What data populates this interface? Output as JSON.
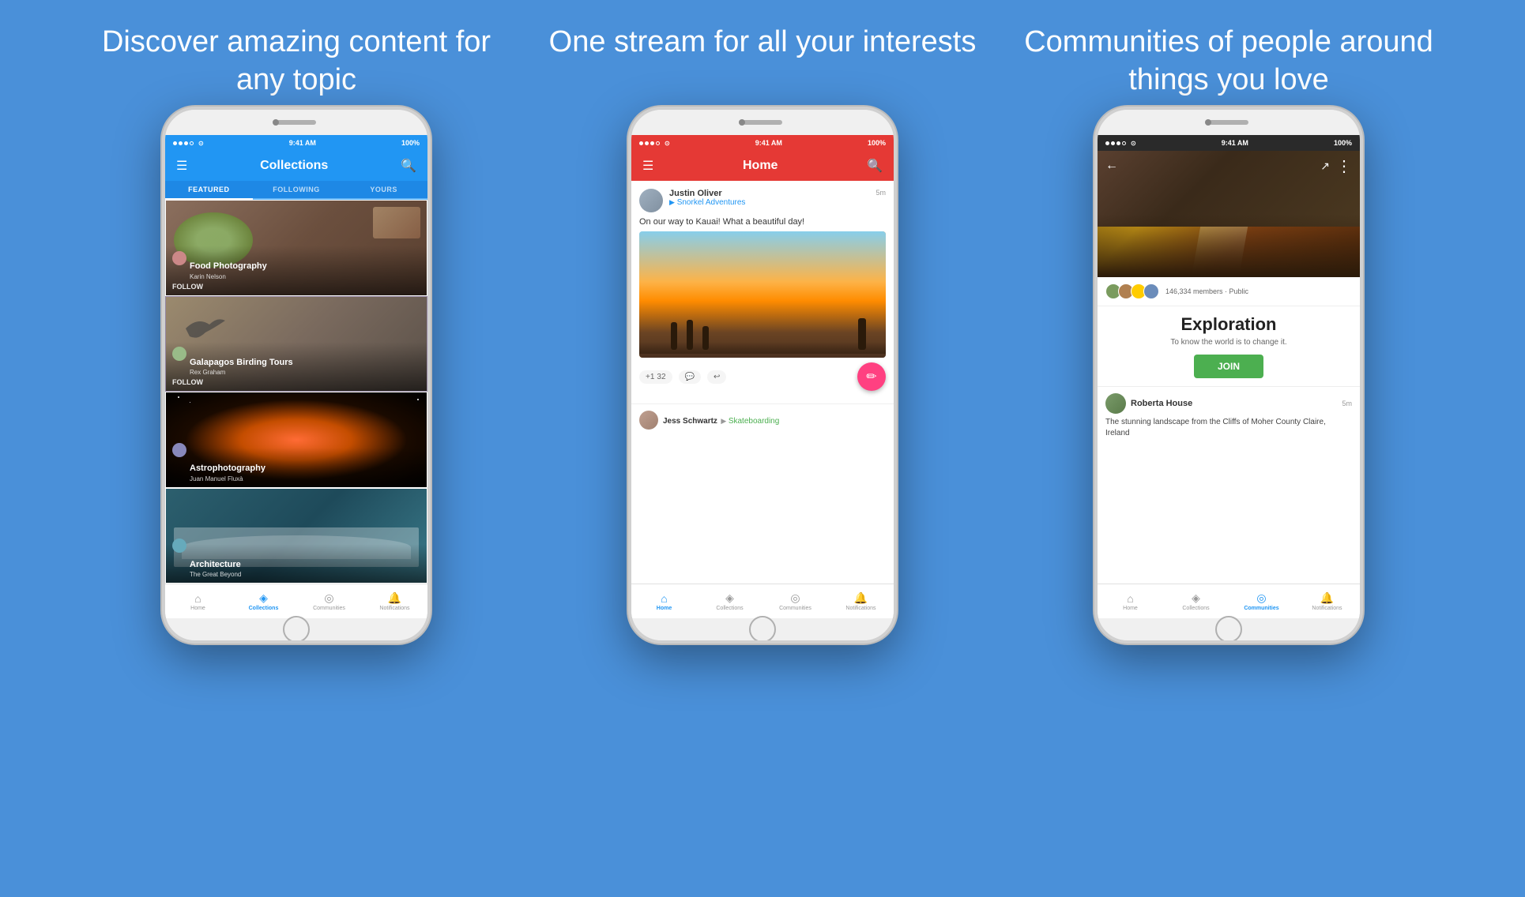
{
  "headlines": {
    "left": "Discover amazing content for any topic",
    "center": "One stream for all your interests",
    "right": "Communities of people around things you love"
  },
  "phone1": {
    "status_time": "9:41 AM",
    "status_battery": "100%",
    "app_bar_title": "Collections",
    "tabs": [
      "FEATURED",
      "FOLLOWING",
      "YOURS"
    ],
    "active_tab": "FEATURED",
    "collections": [
      {
        "title": "Food Photography",
        "author": "Karin Nelson",
        "action": "FOLLOW",
        "color": "#8B6F5E"
      },
      {
        "title": "Galapagos Birding Tours",
        "author": "Rex Graham",
        "action": "FOLLOW",
        "color": "#7B6A8D"
      },
      {
        "title": "Astrophotography",
        "author": "Juan Manuel Fluxà",
        "action": "",
        "color": "#1a1a2e"
      },
      {
        "title": "Architecture",
        "author": "The Great Beyond",
        "action": "",
        "color": "#2c5f6e"
      }
    ],
    "nav_items": [
      {
        "label": "Home",
        "active": false
      },
      {
        "label": "Collections",
        "active": true
      },
      {
        "label": "Communities",
        "active": false
      },
      {
        "label": "Notifications",
        "active": false
      }
    ]
  },
  "phone2": {
    "status_time": "9:41 AM",
    "status_battery": "100%",
    "app_bar_title": "Home",
    "post1": {
      "username": "Justin Oliver",
      "community": "Snorkel Adventures",
      "time": "5m",
      "text": "On our way to Kauai! What a beautiful day!",
      "plus_count": "+1",
      "comment_count": "32"
    },
    "post2": {
      "username": "Jess Schwartz",
      "community": "Skateboarding"
    },
    "nav_items": [
      {
        "label": "Home",
        "active": true
      },
      {
        "label": "Collections",
        "active": false
      },
      {
        "label": "Communities",
        "active": false
      },
      {
        "label": "Notifications",
        "active": false
      }
    ]
  },
  "phone3": {
    "status_time": "9:41 AM",
    "status_battery": "100%",
    "community_name": "Exploration",
    "community_desc": "To know the world is to change it.",
    "member_count": "146,334 members · Public",
    "join_label": "JOIN",
    "post": {
      "username": "Roberta House",
      "time": "5m",
      "text": "The stunning landscape from the Cliffs of Moher County Claire, Ireland"
    },
    "nav_items": [
      {
        "label": "Home",
        "active": false
      },
      {
        "label": "Collections",
        "active": false
      },
      {
        "label": "Communities",
        "active": true
      },
      {
        "label": "Notifications",
        "active": false
      }
    ]
  },
  "icons": {
    "menu": "☰",
    "search": "🔍",
    "home": "⌂",
    "collections": "◈",
    "communities": "◎",
    "notifications": "🔔",
    "back": "←",
    "share": "↗",
    "more": "⋮",
    "edit": "✏",
    "comment": "💬",
    "reshare": "↩"
  }
}
